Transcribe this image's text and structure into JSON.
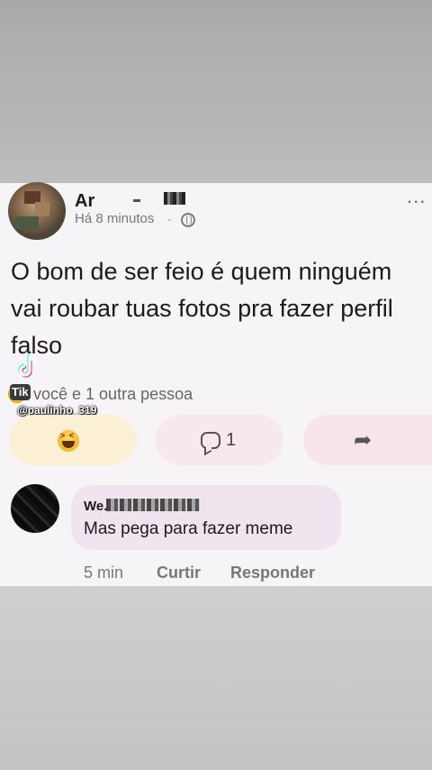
{
  "post": {
    "author_name": "Ar",
    "timestamp": "Há 8 minutos",
    "privacy_icon": "globe-icon",
    "body": "O bom de ser feio é quem ninguém vai roubar tuas fotos pra fazer perfil falso",
    "reactions_text": "você e 1 outra pessoa",
    "tiktok_badge": "Tik",
    "tiktok_username": "@paulinho_319",
    "comment_count": "1"
  },
  "comment": {
    "author_name": "We.",
    "text": "Mas pega para fazer meme",
    "time": "5 min",
    "like_label": "Curtir",
    "reply_label": "Responder"
  },
  "colors": {
    "card_bg": "#f6f4f7",
    "like_pill": "#fbefd5",
    "comment_pill": "#f7e8ef",
    "bubble": "#f0e4ee"
  }
}
